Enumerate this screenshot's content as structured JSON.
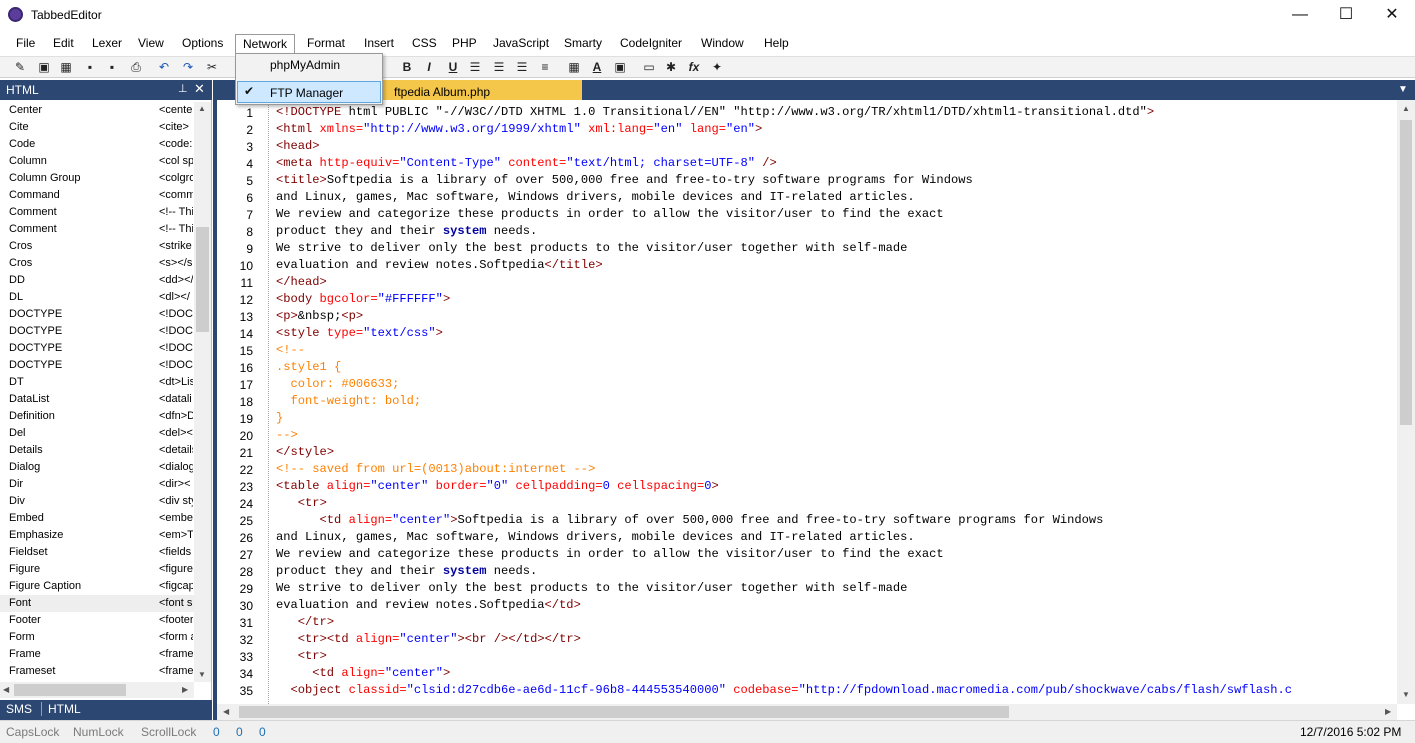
{
  "window": {
    "title": "TabbedEditor",
    "minimize": "—",
    "maximize": "☐",
    "close": "✕"
  },
  "menubar": {
    "items": [
      "File",
      "Edit",
      "Lexer",
      "View",
      "Options",
      "Network",
      "Format",
      "Insert",
      "CSS",
      "PHP",
      "JavaScript",
      "Smarty",
      "CodeIgniter",
      "Window",
      "Help"
    ]
  },
  "network_menu": {
    "items": [
      {
        "label": "phpMyAdmin",
        "checked": false
      },
      {
        "label": "FTP Manager",
        "checked": true
      }
    ],
    "check_glyph": "✔"
  },
  "toolbar": {
    "icons": [
      "new-file-icon",
      "new-template-icon",
      "close-file-icon",
      "save-icon",
      "save-all-icon",
      "print-icon",
      "undo-icon",
      "redo-icon",
      "cut-icon",
      "bold-icon",
      "italic-icon",
      "underline-icon",
      "align-left-icon",
      "align-center-icon",
      "align-right-icon",
      "justify-icon",
      "table-icon",
      "text-color-icon",
      "image-icon",
      "comment-icon",
      "tools-icon",
      "function-icon",
      "magic-icon"
    ],
    "bold": "B",
    "italic": "I",
    "underline": "U",
    "fx": "fx"
  },
  "left_panel": {
    "title": "HTML",
    "pin": "⊥",
    "close": "✕",
    "tabs": [
      "SMS",
      "HTML"
    ],
    "items": [
      {
        "name": "Center",
        "code": "<cente"
      },
      {
        "name": "Cite",
        "code": "<cite>"
      },
      {
        "name": "Code",
        "code": "<code:"
      },
      {
        "name": "Column",
        "code": "<col sp"
      },
      {
        "name": "Column Group",
        "code": "<colgro"
      },
      {
        "name": "Command",
        "code": "<comm"
      },
      {
        "name": "Comment",
        "code": "<!-- Thi"
      },
      {
        "name": "Comment",
        "code": "<!-- Thi"
      },
      {
        "name": "Cros",
        "code": "<strike"
      },
      {
        "name": "Cros",
        "code": "<s></s"
      },
      {
        "name": "DD",
        "code": "<dd></"
      },
      {
        "name": "DL",
        "code": "<dl></"
      },
      {
        "name": "DOCTYPE",
        "code": "<!DOC"
      },
      {
        "name": "DOCTYPE",
        "code": "<!DOC"
      },
      {
        "name": "DOCTYPE",
        "code": "<!DOC"
      },
      {
        "name": "DOCTYPE",
        "code": "<!DOC"
      },
      {
        "name": "DT",
        "code": "<dt>Lis"
      },
      {
        "name": "DataList",
        "code": "<datali"
      },
      {
        "name": "Definition",
        "code": "<dfn>D"
      },
      {
        "name": "Del",
        "code": "<del><"
      },
      {
        "name": "Details",
        "code": "<details"
      },
      {
        "name": "Dialog",
        "code": "<dialog"
      },
      {
        "name": "Dir",
        "code": "<dir><"
      },
      {
        "name": "Div",
        "code": "<div sty"
      },
      {
        "name": "Embed",
        "code": "<embe"
      },
      {
        "name": "Emphasize",
        "code": "<em>T"
      },
      {
        "name": "Fieldset",
        "code": "<fields"
      },
      {
        "name": "Figure",
        "code": "<figure"
      },
      {
        "name": "Figure Caption",
        "code": "<figcap"
      },
      {
        "name": "Font",
        "code": "<font s"
      },
      {
        "name": "Footer",
        "code": "<footer"
      },
      {
        "name": "Form",
        "code": "<form a"
      },
      {
        "name": "Frame",
        "code": "<frame"
      },
      {
        "name": "Frameset",
        "code": "<frame"
      }
    ],
    "selected_index": 29
  },
  "document_tab": {
    "label": "ftpedia Album.php"
  },
  "editor": {
    "line_numbers": [
      "1",
      "2",
      "3",
      "4",
      "5",
      "6",
      "7",
      "8",
      "9",
      "10",
      "11",
      "12",
      "13",
      "14",
      "15",
      "16",
      "17",
      "18",
      "19",
      "20",
      "21",
      "22",
      "23",
      "24",
      "25",
      "26",
      "27",
      "28",
      "29",
      "30",
      "31",
      "32",
      "33",
      "34",
      "35"
    ],
    "lines": [
      "<!DOCTYPE html PUBLIC \"-//W3C//DTD XHTML 1.0 Transitional//EN\" \"http://www.w3.org/TR/xhtml1/DTD/xhtml1-transitional.dtd\">",
      "<html xmlns=\"http://www.w3.org/1999/xhtml\" xml:lang=\"en\" lang=\"en\">",
      "<head>",
      "<meta http-equiv=\"Content-Type\" content=\"text/html; charset=UTF-8\" />",
      "<title>Softpedia is a library of over 500,000 free and free-to-try software programs for Windows",
      "and Linux, games, Mac software, Windows drivers, mobile devices and IT-related articles.",
      "We review and categorize these products in order to allow the visitor/user to find the exact",
      "product they and their system needs.",
      "We strive to deliver only the best products to the visitor/user together with self-made",
      "evaluation and review notes.Softpedia</title>",
      "</head>",
      "<body bgcolor=\"#FFFFFF\">",
      "<p>&nbsp;<p>",
      "<style type=\"text/css\">",
      "<!--",
      ".style1 {",
      "  color: #006633;",
      "  font-weight: bold;",
      "}",
      "-->",
      "</style>",
      "<!-- saved from url=(0013)about:internet -->",
      "<table align=\"center\" border=\"0\" cellpadding=0 cellspacing=0>",
      "   <tr>",
      "      <td align=\"center\">Softpedia is a library of over 500,000 free and free-to-try software programs for Windows",
      "and Linux, games, Mac software, Windows drivers, mobile devices and IT-related articles.",
      "We review and categorize these products in order to allow the visitor/user to find the exact",
      "product they and their system needs.",
      "We strive to deliver only the best products to the visitor/user together with self-made",
      "evaluation and review notes.Softpedia</td>",
      "   </tr>",
      "   <tr><td align=\"center\"><br /></td></tr>",
      "   <tr>",
      "     <td align=\"center\">",
      "  <object classid=\"clsid:d27cdb6e-ae6d-11cf-96b8-444553540000\" codebase=\"http://fpdownload.macromedia.com/pub/shockwave/cabs/flash/swflash.c"
    ]
  },
  "status": {
    "capslock": "CapsLock",
    "numlock": "NumLock",
    "scrolllock": "ScrollLock",
    "val1": "0",
    "val2": "0",
    "val3": "0",
    "datetime": "12/7/2016 5:02 PM"
  },
  "colors": {
    "panel_header": "#2c4772",
    "active_tab": "#f4c64a",
    "menu_highlight": "#cde8ff"
  }
}
